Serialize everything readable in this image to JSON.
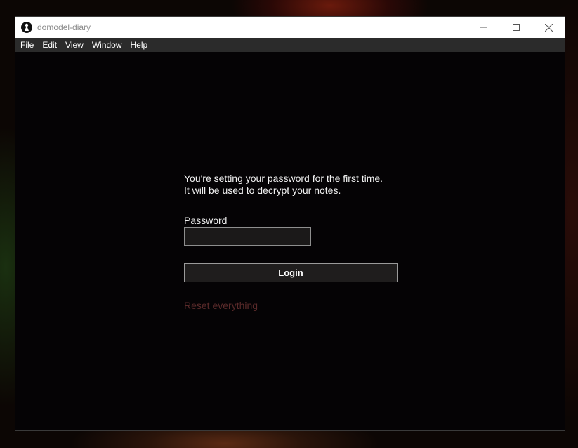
{
  "window": {
    "title": "domodel-diary"
  },
  "menu": {
    "items": [
      "File",
      "Edit",
      "View",
      "Window",
      "Help"
    ]
  },
  "login": {
    "intro_line1": "You're setting your password for the first time.",
    "intro_line2": "It will be used to decrypt your notes.",
    "password_label": "Password",
    "password_value": "",
    "login_button": "Login",
    "reset_link": "Reset everything"
  },
  "colors": {
    "window_bg": "#050305",
    "menubar_bg": "#2b2b2b",
    "titlebar_bg": "#ffffff",
    "reset_link": "#5a2a2a"
  },
  "icons": {
    "app": "app-logo-icon",
    "minimize": "minimize-icon",
    "maximize": "maximize-icon",
    "close": "close-icon"
  }
}
